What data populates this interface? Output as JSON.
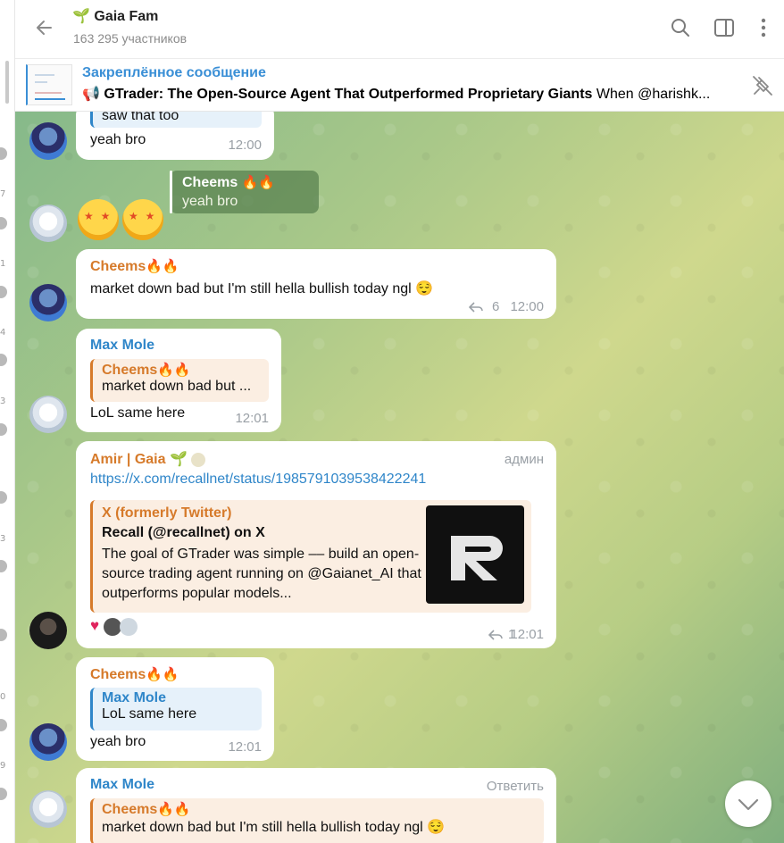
{
  "header": {
    "title": "Gaia Fam",
    "subtitle": "163 295 участников"
  },
  "pinned": {
    "label": "Закреплённое сообщение",
    "title": "GTrader: The Open-Source Agent That Outperformed Proprietary Giants",
    "preview": "When @harishk..."
  },
  "left_strip_numbers": [
    "7",
    "1",
    "4",
    "3",
    "3",
    "0",
    "9"
  ],
  "messages": [
    {
      "reply_text": "saw that too",
      "text": "yeah bro",
      "time": "12:00"
    },
    {
      "own_reply_name": "Cheems",
      "own_reply_text": "yeah bro"
    },
    {
      "name": "Cheems",
      "text": "market down bad but I'm still hella bullish today ngl 😌",
      "replies": "6",
      "time": "12:00"
    },
    {
      "name": "Max Mole",
      "reply_name": "Cheems",
      "reply_text": "market down bad but ...",
      "text": "LoL same here",
      "time": "12:01"
    },
    {
      "name": "Amir | Gaia",
      "role": "админ",
      "link": "https://x.com/recallnet/status/1985791039538422241",
      "preview_site": "X (formerly Twitter)",
      "preview_title": "Recall (@recallnet) on X",
      "preview_desc": "The goal of GTrader was simple –– build an open-source trading agent running on @Gaianet_AI that outperforms popular models...",
      "replies": "1",
      "time": "12:01"
    },
    {
      "name": "Cheems",
      "reply_name": "Max Mole",
      "reply_text": "LoL same here",
      "text": "yeah bro",
      "time": "12:01"
    },
    {
      "name": "Max Mole",
      "action": "Ответить",
      "reply_name": "Cheems",
      "reply_text": "market down bad but I'm still hella bullish today ngl 😌"
    }
  ],
  "colors": {
    "accent": "#3a8fd6",
    "orange_name": "#d67a2a",
    "blue_name": "#2f86c9"
  }
}
